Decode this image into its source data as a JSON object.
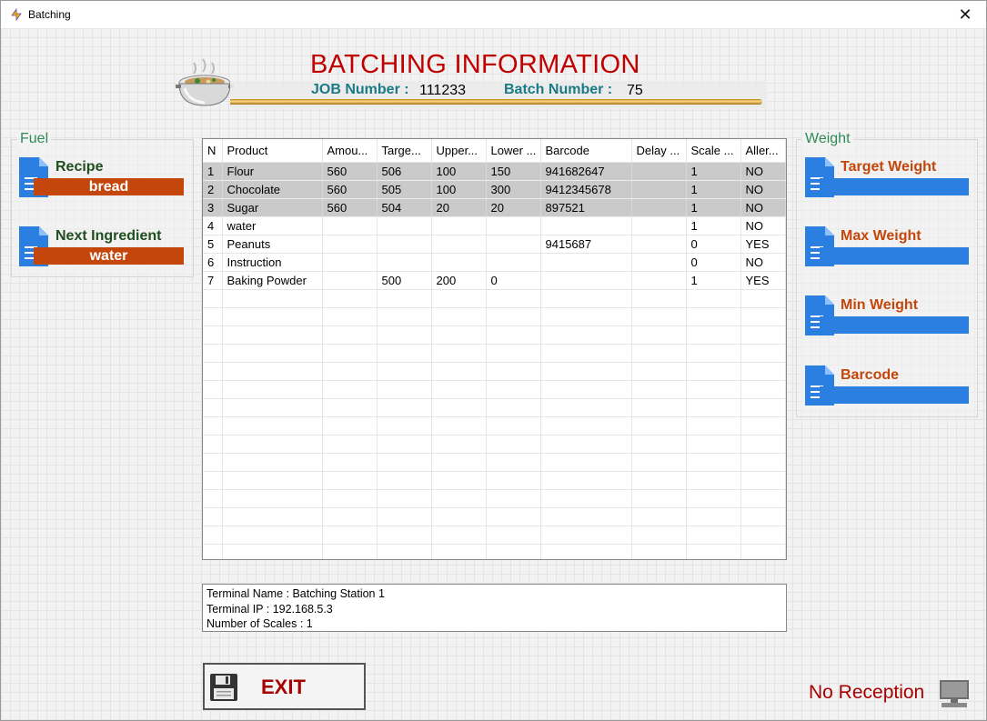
{
  "window": {
    "title": "Batching",
    "close_glyph": "✕"
  },
  "header": {
    "title": "BATCHING INFORMATION",
    "job_label": "JOB Number :",
    "job_value": "111233",
    "batch_label": "Batch Number :",
    "batch_value": "75",
    "icon": "soup-pot-icon"
  },
  "fuel": {
    "group_label": "Fuel",
    "recipe_label": "Recipe",
    "recipe_value": "bread",
    "next_label": "Next Ingredient",
    "next_value": "water"
  },
  "weight": {
    "group_label": "Weight",
    "target_label": "Target Weight",
    "target_value": "",
    "max_label": "Max Weight",
    "max_value": "",
    "min_label": "Min Weight",
    "min_value": "",
    "barcode_label": "Barcode",
    "barcode_value": ""
  },
  "table": {
    "columns": [
      "N",
      "Product",
      "Amou...",
      "Targe...",
      "Upper...",
      "Lower ...",
      "Barcode",
      "Delay ...",
      "Scale ...",
      "Aller..."
    ],
    "rows": [
      {
        "selected": true,
        "cells": [
          "1",
          "Flour",
          "560",
          "506",
          "100",
          "150",
          "941682647",
          "",
          "1",
          "NO"
        ]
      },
      {
        "selected": true,
        "cells": [
          "2",
          "Chocolate",
          "560",
          "505",
          "100",
          "300",
          "9412345678",
          "",
          "1",
          "NO"
        ]
      },
      {
        "selected": true,
        "cells": [
          "3",
          "Sugar",
          "560",
          "504",
          "20",
          "20",
          "897521",
          "",
          "1",
          "NO"
        ]
      },
      {
        "selected": false,
        "cells": [
          "4",
          "water",
          "",
          "",
          "",
          "",
          "",
          "",
          "1",
          "NO"
        ]
      },
      {
        "selected": false,
        "cells": [
          "5",
          "Peanuts",
          "",
          "",
          "",
          "",
          "9415687",
          "",
          "0",
          "YES"
        ]
      },
      {
        "selected": false,
        "cells": [
          "6",
          "Instruction",
          "",
          "",
          "",
          "",
          "",
          "",
          "0",
          "NO"
        ]
      },
      {
        "selected": false,
        "cells": [
          "7",
          "Baking Powder",
          "",
          "500",
          "200",
          "0",
          "",
          "",
          "1",
          "YES"
        ]
      }
    ]
  },
  "info": {
    "terminal_name": "Terminal Name : Batching Station 1",
    "terminal_ip": "Terminal IP :  192.168.5.3",
    "scales": "Number of Scales :  1"
  },
  "exit": {
    "label": "EXIT",
    "icon": "floppy-disk-icon"
  },
  "status": {
    "reception": "No Reception",
    "icon": "monitor-icon"
  },
  "colors": {
    "title_red": "#c00000",
    "teal": "#1a7a85",
    "orange_bar": "#c4460a",
    "blue_bar": "#2a7fe0",
    "weight_label": "#c4460a",
    "fuel_label": "#1f4e1f",
    "group_label": "#2e8b57",
    "selected_row": "#cacaca"
  }
}
